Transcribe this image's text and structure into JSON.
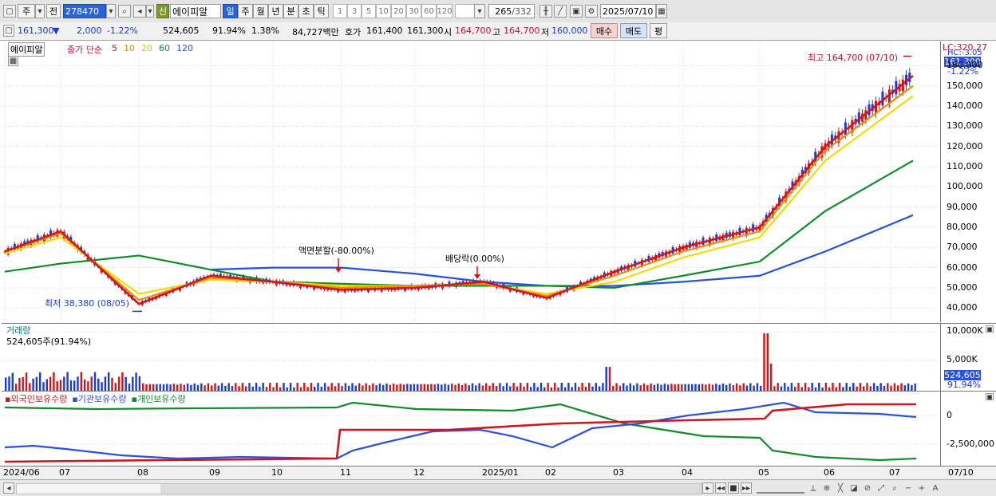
{
  "toolbar": {
    "market_label": "주",
    "prev_label": "전",
    "stock_code": "278470",
    "stock_name": "에이피알",
    "new_badge": "신",
    "periods": [
      "일",
      "주",
      "월",
      "년",
      "분",
      "초",
      "틱"
    ],
    "active_period": "일",
    "intervals": [
      "1",
      "3",
      "5",
      "10",
      "20",
      "30",
      "60",
      "120"
    ],
    "count": "265",
    "total": "/332",
    "date": "2025/07/10"
  },
  "quote": {
    "price": "161,300",
    "change_arrow": "▼",
    "change": "2,000",
    "change_pct": "-1.22%",
    "volume": "524,605",
    "volume_ratio": "91.94%",
    "turnover_pct": "1.38%",
    "amount": "84,727백만",
    "bid_label": "호가",
    "ask_price": "161,400",
    "bid_price": "161,300",
    "open_label": "시",
    "open": "164,700",
    "high_label": "고",
    "high": "164,700",
    "low_label": "저",
    "low": "160,000",
    "buy_label": "매수",
    "sell_label": "매도",
    "eval_label": "평"
  },
  "legend": {
    "name": "에이피알",
    "ma_label": "종가 단순",
    "ma": [
      {
        "period": "5",
        "color": "#d4141c"
      },
      {
        "period": "10",
        "color": "#f08c00"
      },
      {
        "period": "20",
        "color": "#e6c800"
      },
      {
        "period": "60",
        "color": "#118a2c"
      },
      {
        "period": "120",
        "color": "#2b50e0"
      }
    ]
  },
  "annotations": {
    "high_note": "최고 164,700 (07/10)",
    "low_note": "최저 38,380 (08/05)",
    "split_note": "액면분할(-80.00%)",
    "dividend_note": "배당락(0.00%)",
    "lc_label": "LC:320.27",
    "hc_label": "HC:-3.05",
    "price_tag": "161,300",
    "pct_tag": "-1.22%",
    "vol_title": "거래량",
    "vol_info": "524,605주(91.94%)",
    "vol_tag": "524,605",
    "vol_pct_tag": "91.94%",
    "holder_series": [
      {
        "label": "외국인보유수량",
        "color": "#d4141c"
      },
      {
        "label": "기관보유수량",
        "color": "#2b50e0"
      },
      {
        "label": "개인보유수량",
        "color": "#118a2c"
      }
    ]
  },
  "axes": {
    "price_ticks": [
      "160,000",
      "150,000",
      "140,000",
      "130,000",
      "120,000",
      "110,000",
      "100,000",
      "90,000",
      "80,000",
      "70,000",
      "60,000",
      "50,000",
      "40,000"
    ],
    "volume_ticks": [
      "10,000K",
      "5,000K"
    ],
    "holder_ticks": [
      "0",
      "-2,500,000"
    ],
    "x_labels": [
      "2024/06",
      "07",
      "08",
      "09",
      "10",
      "11",
      "12",
      "2025/01",
      "02",
      "03",
      "04",
      "05",
      "06",
      "07"
    ],
    "x_end": "07/10"
  },
  "chart_data": {
    "type": "line",
    "x": [
      "2024/06",
      "2024/07",
      "2024/08",
      "2024/09",
      "2024/10",
      "2024/11",
      "2024/12",
      "2025/01",
      "2025/02",
      "2025/03",
      "2025/04",
      "2025/05",
      "2025/06",
      "2025/07"
    ],
    "series": [
      {
        "name": "5",
        "values": [
          68000,
          78000,
          42000,
          56000,
          53000,
          49000,
          50000,
          53000,
          45000,
          58000,
          70000,
          80000,
          120000,
          155000
        ]
      },
      {
        "name": "10",
        "values": [
          68000,
          77000,
          44000,
          55000,
          53000,
          50000,
          51000,
          52000,
          46000,
          56000,
          68000,
          78000,
          118000,
          150000
        ]
      },
      {
        "name": "20",
        "values": [
          67000,
          75000,
          47000,
          54000,
          53000,
          51000,
          51000,
          52000,
          47000,
          53000,
          65000,
          75000,
          113000,
          145000
        ]
      },
      {
        "name": "60",
        "values": [
          58000,
          62000,
          66000,
          59000,
          53000,
          52000,
          51000,
          51000,
          51000,
          50000,
          56000,
          63000,
          88000,
          113000
        ]
      },
      {
        "name": "120",
        "values": [
          null,
          null,
          null,
          59000,
          60000,
          60000,
          57000,
          53000,
          51000,
          51000,
          53000,
          56000,
          68000,
          86000
        ]
      }
    ],
    "ylim": [
      33000,
      172000
    ],
    "high": {
      "value": 164700,
      "date": "07/10"
    },
    "low": {
      "value": 38380,
      "date": "08/05"
    }
  }
}
